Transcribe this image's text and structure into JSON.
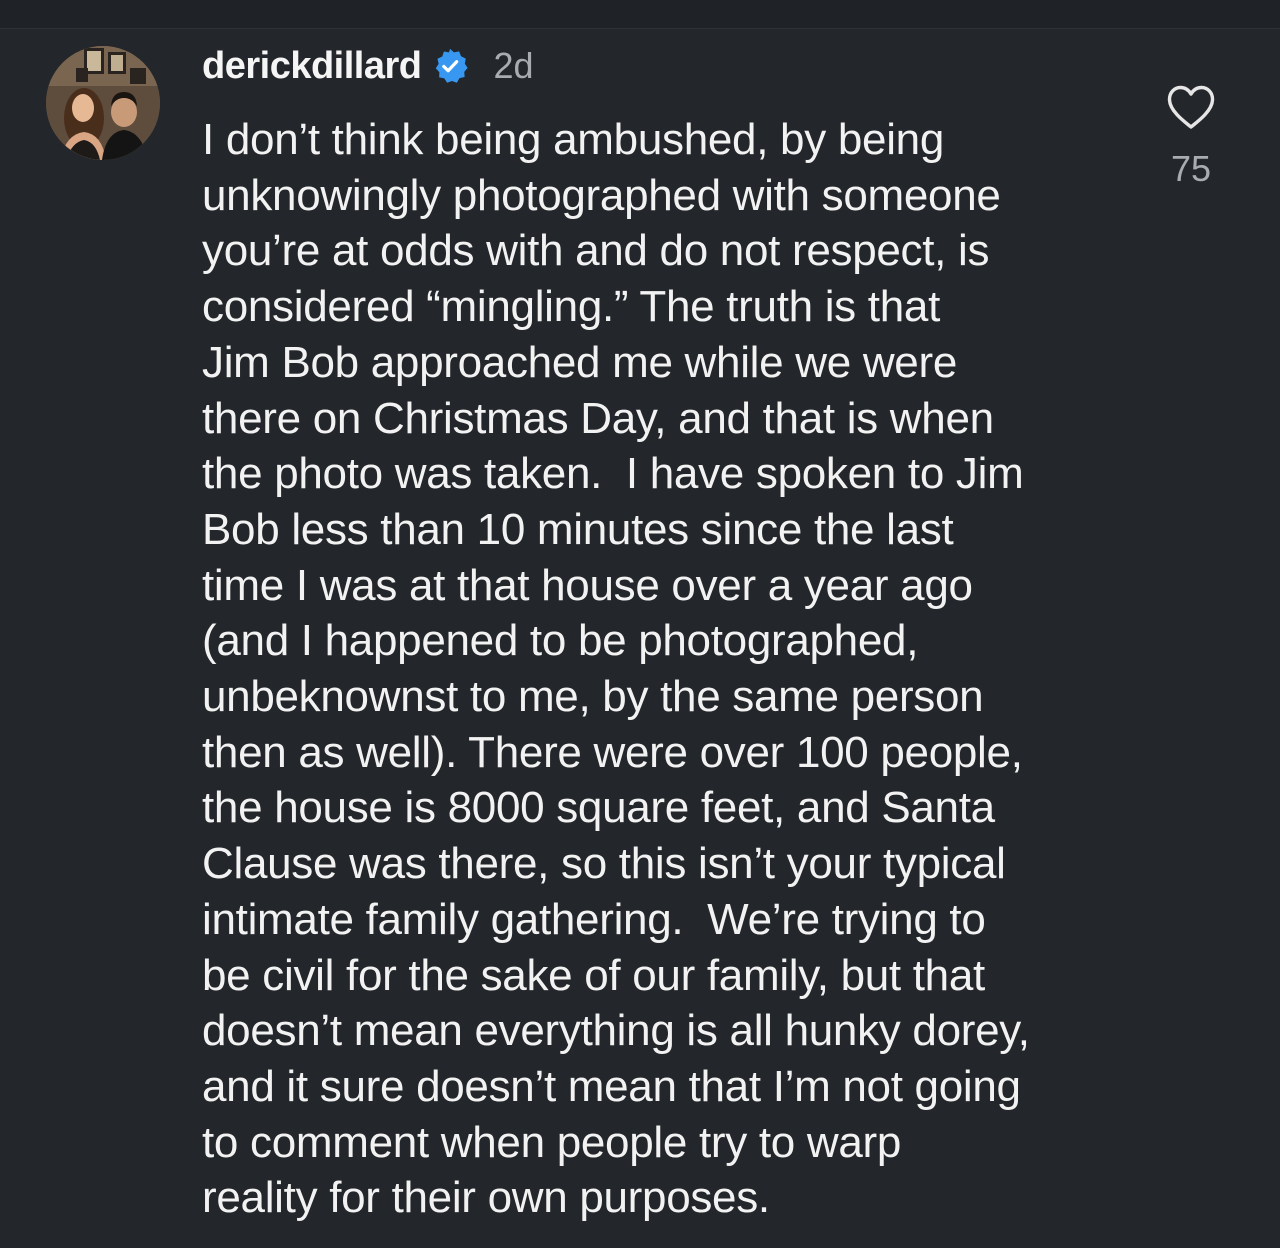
{
  "comment": {
    "username": "derickdillard",
    "verified": true,
    "age": "2d",
    "avatar_icon": "profile-photo-couple",
    "lines": [
      "I don’t think being ambushed, by being",
      "unknowingly photographed with someone",
      "you’re at odds with and do not respect, is",
      "considered “mingling.” The truth is that",
      "Jim Bob approached me while we were",
      "there on Christmas Day, and that is when",
      "the photo was taken.  I have spoken to Jim",
      "Bob less than 10 minutes since the last",
      "time I was at that house over a year ago",
      "(and I happened to be photographed,",
      "unbeknownst to me, by the same person",
      "then as well). There were over 100 people,",
      "the house is 8000 square feet, and Santa",
      "Clause was there, so this isn’t your typical",
      "intimate family gathering.  We’re trying to",
      "be civil for the sake of our family, but that",
      "doesn’t mean everything is all hunky dorey,",
      "and it sure doesn’t mean that I’m not going",
      "to comment when people try to warp",
      "reality for their own purposes."
    ],
    "like_icon": "heart-outline-icon",
    "like_count": "75"
  },
  "colors": {
    "background": "#23262a",
    "text": "#f2f2f2",
    "muted": "#a8acb1",
    "verified_badge": "#3897f0"
  }
}
